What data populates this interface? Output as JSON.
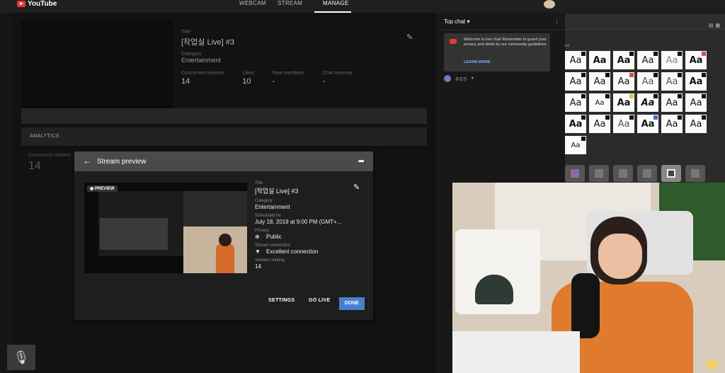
{
  "header": {
    "logo_text": "YouTube",
    "tabs": [
      {
        "label": "WEBCAM"
      },
      {
        "label": "STREAM"
      },
      {
        "label": "MANAGE"
      }
    ]
  },
  "stream_info": {
    "title_label": "Title",
    "title": "[작업실 Live] #3",
    "category_label": "Category",
    "category": "Entertainment",
    "stats": [
      {
        "label": "Concurrent viewers",
        "value": "14"
      },
      {
        "label": "Likes",
        "value": "10"
      },
      {
        "label": "New members",
        "value": "-"
      },
      {
        "label": "Chat revenue",
        "value": "-"
      }
    ]
  },
  "analytics": {
    "heading": "ANALYTICS",
    "concurrent_label": "Concurrent viewers",
    "concurrent_value": "14"
  },
  "modal": {
    "title": "Stream preview",
    "preview_badge": "PREVIEW",
    "fields": {
      "title_label": "Title",
      "title": "[작업실 Live] #3",
      "category_label": "Category",
      "category": "Entertainment",
      "scheduled_label": "Scheduled for",
      "scheduled": "July 18, 2019 at 9:00 PM (GMT+...",
      "privacy_label": "Privacy",
      "privacy": "Public",
      "connection_label": "Stream connection",
      "connection": "Excellent connection",
      "viewers_label": "Viewers waiting",
      "viewers": "14"
    },
    "buttons": {
      "settings": "SETTINGS",
      "go_live": "GO LIVE",
      "done": "DONE"
    }
  },
  "chat": {
    "header": "Top chat",
    "welcome_text": "Welcome to live chat! Remember to guard your privacy and abide by our community guidelines.",
    "learn_more": "LEARN MORE",
    "messages": [
      {
        "author": "주호진"
      }
    ]
  },
  "font_panel": {
    "section_label": "es",
    "samples": [
      "Aa",
      "Aa",
      "Aa",
      "Aa",
      "Aa",
      "Aa",
      "Aa",
      "Aa",
      "Aa",
      "Aa",
      "Aa",
      "Aa",
      "Aa",
      "Aa",
      "Aa",
      "Aa",
      "Aa",
      "Aa",
      "Aa",
      "Aa",
      "Aa",
      "Aa",
      "Aa",
      "Aa",
      "Aa"
    ]
  },
  "colors": {
    "accent_blue": "#4a7fcf",
    "youtube_red": "#e53935",
    "link_blue": "#7ab2ff"
  }
}
